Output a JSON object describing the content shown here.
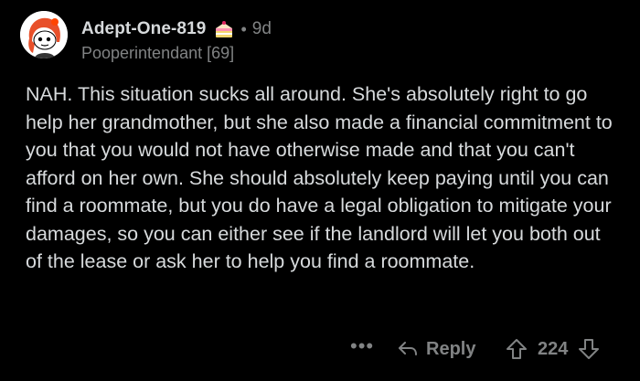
{
  "comment": {
    "username": "Adept-One-819",
    "award_icon": "cake-icon",
    "separator": "•",
    "age": "9d",
    "flair": "Pooperintendant [69]",
    "body": "NAH. This situation sucks all around. She's absolutely right to go help her grandmother, but she also made a financial commitment to you that you would not have otherwise made and that you can't afford on her own. She should absolutely keep paying until you can find a roommate, but you do have a legal obligation to mitigate your damages, so you can either see if the landlord will let you both out of the lease or ask her to help you find a roommate."
  },
  "actions": {
    "more_label": "•••",
    "reply_label": "Reply",
    "vote_count": "224"
  },
  "colors": {
    "background": "#000000",
    "text": "#d7dadc",
    "muted": "#818384",
    "avatar_hair": "#e8502a"
  }
}
